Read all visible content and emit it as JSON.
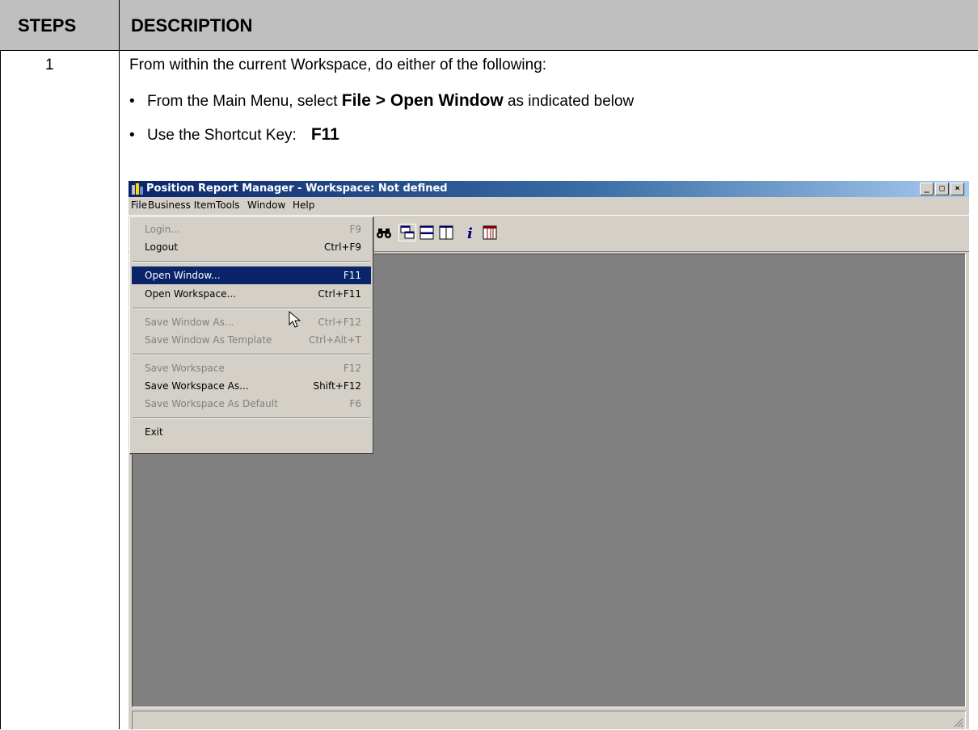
{
  "table": {
    "header_steps": "STEPS",
    "header_description": "DESCRIPTION",
    "step_number": "1",
    "intro": "From within the current Workspace, do either of the following:",
    "bullet1_prefix": "From the Main Menu, select ",
    "bullet1_bold": "File > Open Window",
    "bullet1_suffix": " as indicated below",
    "bullet2_prefix": "Use the Shortcut Key:",
    "bullet2_bold": "F11",
    "bullet_char": "•"
  },
  "window": {
    "title": "Position Report Manager - Workspace: Not defined",
    "controls": [
      "_",
      "□",
      "×"
    ],
    "menubar": [
      "File",
      "Business Item",
      "Tools",
      "Window",
      "Help"
    ],
    "toolbar_icons": [
      "find-binoculars-icon",
      "cascade-windows-icon",
      "tile-horizontal-icon",
      "tile-vertical-icon",
      "info-icon",
      "columns-icon"
    ]
  },
  "file_menu": {
    "items": [
      {
        "label": "Login...",
        "shortcut": "F9",
        "state": "disabled"
      },
      {
        "label": "Logout",
        "shortcut": "Ctrl+F9",
        "state": "enabled"
      },
      {
        "label": "Open Window...",
        "shortcut": "F11",
        "state": "selected"
      },
      {
        "label": "Open Workspace...",
        "shortcut": "Ctrl+F11",
        "state": "enabled"
      },
      {
        "label": "Save Window As...",
        "shortcut": "Ctrl+F12",
        "state": "disabled"
      },
      {
        "label": "Save Window As Template",
        "shortcut": "Ctrl+Alt+T",
        "state": "disabled"
      },
      {
        "label": "Save Workspace",
        "shortcut": "F12",
        "state": "disabled"
      },
      {
        "label": "Save Workspace As...",
        "shortcut": "Shift+F12",
        "state": "enabled"
      },
      {
        "label": "Save Workspace As Default",
        "shortcut": "F6",
        "state": "disabled"
      },
      {
        "label": "Exit",
        "shortcut": "",
        "state": "enabled"
      }
    ]
  },
  "colors": {
    "header_bg": "#bfbfbf",
    "titlebar_start": "#0a246a",
    "titlebar_end": "#a6caf0",
    "menu_selected": "#0a246a",
    "mdi_bg": "#808080",
    "window_face": "#d4d0c8"
  }
}
